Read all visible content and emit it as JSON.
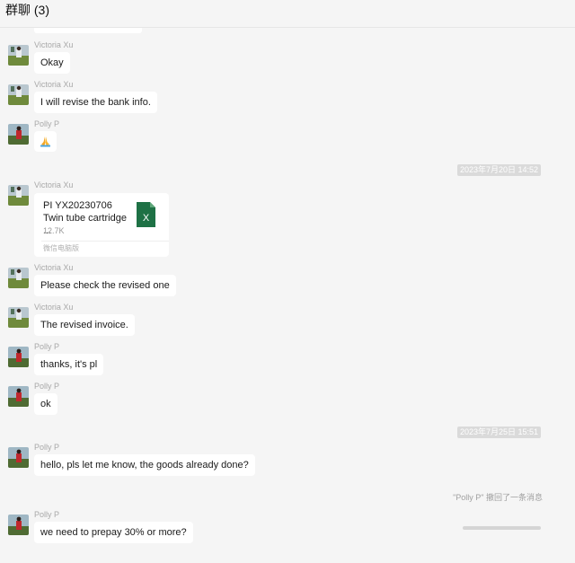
{
  "window": {
    "title": "群聊 (3)"
  },
  "file_message": {
    "sender": "Victoria Xu",
    "file_name": "PI YX20230706 Twin tube cartridge ...",
    "file_size": "12.7K",
    "source": "微信电脑版",
    "file_icon": "excel-file-icon",
    "file_icon_letter": "X"
  },
  "messages": [
    {
      "sender": "Victoria Xu",
      "text": "Okay",
      "avatar": "victoria-avatar"
    },
    {
      "sender": "Victoria Xu",
      "text": "I will revise the bank info.",
      "avatar": "victoria-avatar"
    },
    {
      "sender": "Polly P",
      "text": "🙏",
      "avatar": "polly-avatar"
    },
    {
      "sender": "Victoria Xu",
      "text": "Please check the revised one",
      "avatar": "victoria-avatar"
    },
    {
      "sender": "Victoria Xu",
      "text": "The revised invoice.",
      "avatar": "victoria-avatar"
    },
    {
      "sender": "Polly P",
      "text": "thanks, it's pl",
      "avatar": "polly-avatar"
    },
    {
      "sender": "Polly P",
      "text": "ok",
      "avatar": "polly-avatar"
    },
    {
      "sender": "Polly P",
      "text": "hello, pls let me know, the goods already done?",
      "avatar": "polly-avatar"
    },
    {
      "sender": "Polly P",
      "text": "we need to prepay 30% or more?",
      "avatar": "polly-avatar"
    }
  ],
  "timestamps": [
    "2023年7月20日 14:52",
    "2023年7月25日 15:51"
  ],
  "recall_notice": "\"Polly P\" 撤回了一条消息",
  "colors": {
    "background": "#f5f5f5",
    "bubble": "#ffffff",
    "excel": "#1e7145",
    "timestamp_bg": "#dadada"
  }
}
